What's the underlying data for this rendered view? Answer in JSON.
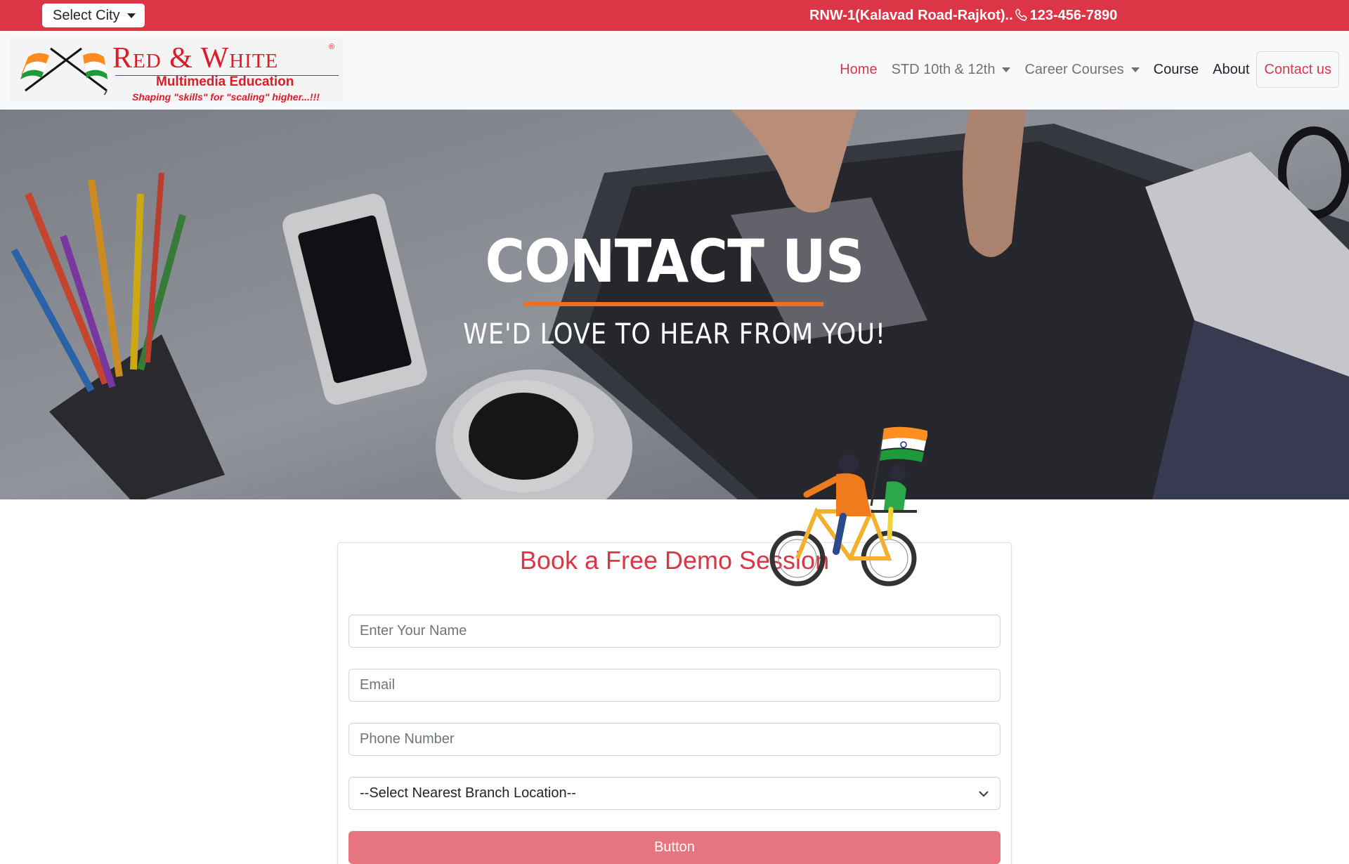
{
  "topbar": {
    "city_label": "Select City",
    "contact_text": "RNW-1(Kalavad Road-Rajkot)..",
    "phone": "123-456-7890"
  },
  "brand": {
    "name": "Red & White",
    "subtitle": "Multimedia Education",
    "tagline": "Shaping \"skills\" for \"scaling\" higher...!!!"
  },
  "nav": {
    "home": "Home",
    "std": "STD 10th & 12th",
    "career": "Career Courses",
    "course": "Course",
    "about": "About",
    "contact": "Contact us"
  },
  "hero": {
    "title": "CONTACT US",
    "subtitle": "WE'D LOVE TO HEAR FROM YOU!"
  },
  "form": {
    "title": "Book a Free Demo Session",
    "name_placeholder": "Enter Your Name",
    "email_placeholder": "Email",
    "phone_placeholder": "Phone Number",
    "branch_selected": "--Select Nearest Branch Location--",
    "submit_label": "Button"
  },
  "colors": {
    "primary": "#dc3545",
    "submit_bg": "#e6757f",
    "accent_orange": "#f06e1d"
  },
  "icons": [
    "caret-down-icon",
    "phone-icon",
    "chevron-down-icon",
    "india-flag-icon"
  ]
}
